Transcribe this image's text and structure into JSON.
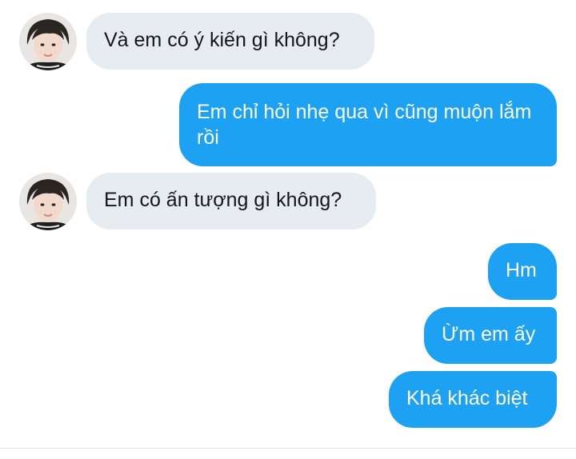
{
  "conversation": {
    "messages": [
      {
        "sender": "other",
        "text": "Và em có ý kiến gì không?"
      },
      {
        "sender": "me",
        "text": "Em chỉ hỏi nhẹ qua vì cũng muộn lắm rồi"
      },
      {
        "sender": "other",
        "text": "Em có ấn tượng gì không?"
      },
      {
        "sender": "me",
        "text": "Hm"
      },
      {
        "sender": "me",
        "text": "Ừm em ấy"
      },
      {
        "sender": "me",
        "text": "Khá khác biệt"
      }
    ]
  },
  "colors": {
    "outgoing_bubble": "#1da1f2",
    "incoming_bubble": "#e6ecf0",
    "background": "#ffffff"
  },
  "icons": {
    "avatar": "contact-avatar-photo"
  }
}
